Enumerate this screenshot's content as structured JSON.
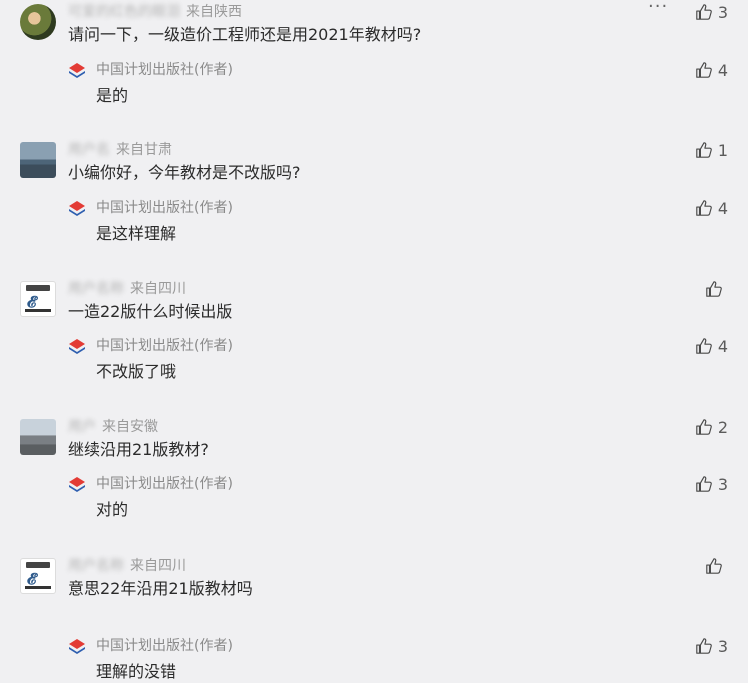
{
  "comments": [
    {
      "username": "可爱的红色的眼泪",
      "location": "来自陕西",
      "text": "请问一下，一级造价工程师还是用2021年教材吗?",
      "likes": "3",
      "avatar": "photo-avatar",
      "reply": {
        "author": "中国计划出版社(作者)",
        "text": "是的",
        "likes": "4"
      }
    },
    {
      "username": "用户名",
      "location": "来自甘肃",
      "text": "小编你好，今年教材是不改版吗?",
      "likes": "1",
      "avatar": "sea-avatar",
      "reply": {
        "author": "中国计划出版社(作者)",
        "text": "是这样理解",
        "likes": "4"
      }
    },
    {
      "username": "用户名称",
      "location": "来自四川",
      "text": "一造22版什么时候出版",
      "likes": "",
      "avatar": "logo-avatar",
      "reply": {
        "author": "中国计划出版社(作者)",
        "text": "不改版了哦",
        "likes": "4"
      }
    },
    {
      "username": "用户",
      "location": "来自安徽",
      "text": "继续沿用21版教材?",
      "likes": "2",
      "avatar": "road-avatar",
      "reply": {
        "author": "中国计划出版社(作者)",
        "text": "对的",
        "likes": "3"
      }
    },
    {
      "username": "用户名称",
      "location": "来自四川",
      "text": "意思22年沿用21版教材吗",
      "likes": "",
      "avatar": "logo-avatar",
      "reply": {
        "author": "中国计划出版社(作者)",
        "text": "理解的没错",
        "likes": "3"
      }
    }
  ],
  "more_menu": "···",
  "logo_glyph": "𝓔",
  "colors": {
    "publisher_red": "#e33b35",
    "publisher_blue": "#2f5fb0",
    "background": "#f0f0f2"
  }
}
